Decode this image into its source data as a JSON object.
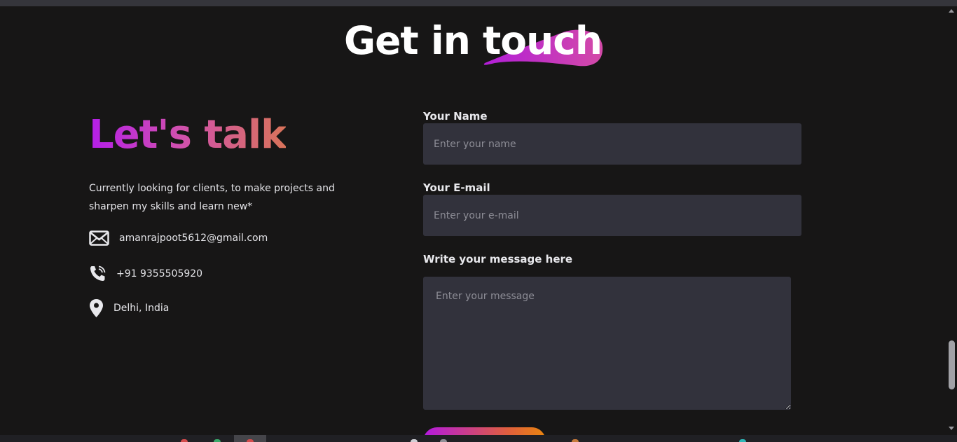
{
  "section": {
    "title_main": "Get in ",
    "title_highlight": "touch"
  },
  "info": {
    "heading": "Let's talk",
    "intro": "Currently looking for clients, to make projects and sharpen my skills and learn new*",
    "contacts": [
      {
        "icon": "mail-icon",
        "text": "amanrajpoot5612@gmail.com"
      },
      {
        "icon": "phone-icon",
        "text": "+91 9355505920"
      },
      {
        "icon": "location-pin-icon",
        "text": "Delhi, India"
      }
    ]
  },
  "form": {
    "name_label": "Your Name",
    "name_placeholder": "Enter your name",
    "email_label": "Your E-mail",
    "email_placeholder": "Enter your e-mail",
    "message_label": "Write your message here",
    "message_placeholder": "Enter your message"
  },
  "colors": {
    "background": "#171616",
    "field_bg": "#32323c",
    "gradient_start": "#b41ee8",
    "gradient_end": "#e8850f"
  }
}
